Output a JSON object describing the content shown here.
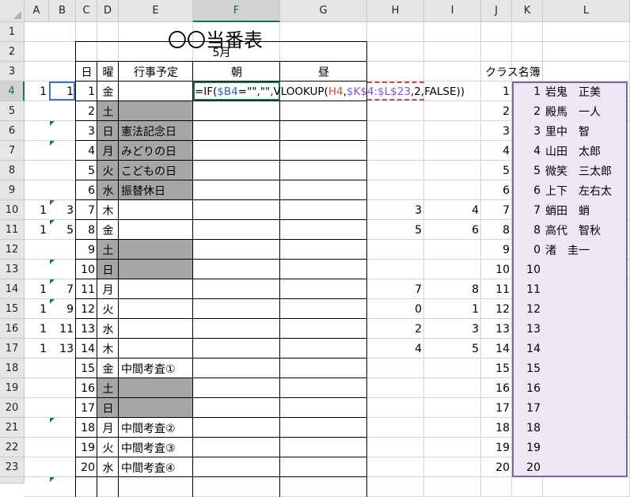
{
  "columns": [
    "A",
    "B",
    "C",
    "D",
    "E",
    "F",
    "G",
    "H",
    "I",
    "J",
    "K",
    "L"
  ],
  "rows": [
    "1",
    "2",
    "3",
    "4",
    "5",
    "6",
    "7",
    "8",
    "9",
    "10",
    "11",
    "12",
    "13",
    "14",
    "15",
    "16",
    "17",
    "18",
    "19",
    "20",
    "21",
    "22",
    "23"
  ],
  "selected_column": "F",
  "selected_row": "4",
  "title": "〇〇当番表",
  "month": "5月",
  "headers": {
    "day": "日",
    "weekday": "曜",
    "event": "行事予定",
    "morning": "朝",
    "noon": "昼"
  },
  "formula_in_cell": "=IF($B4=\"\",\"\",VLOOKUP(H4,$K$4:$L$23,2,FALSE))",
  "class_list_label": "クラス名簿",
  "schedule": [
    {
      "day": "1",
      "wd": "金",
      "ev": "",
      "gray": false
    },
    {
      "day": "2",
      "wd": "土",
      "ev": "",
      "gray": true
    },
    {
      "day": "3",
      "wd": "日",
      "ev": "憲法記念日",
      "gray": true
    },
    {
      "day": "4",
      "wd": "月",
      "ev": "みどりの日",
      "gray": true
    },
    {
      "day": "5",
      "wd": "火",
      "ev": "こどもの日",
      "gray": true
    },
    {
      "day": "6",
      "wd": "水",
      "ev": "振替休日",
      "gray": true
    },
    {
      "day": "7",
      "wd": "木",
      "ev": "",
      "gray": false
    },
    {
      "day": "8",
      "wd": "金",
      "ev": "",
      "gray": false
    },
    {
      "day": "9",
      "wd": "土",
      "ev": "",
      "gray": true
    },
    {
      "day": "10",
      "wd": "日",
      "ev": "",
      "gray": true
    },
    {
      "day": "11",
      "wd": "月",
      "ev": "",
      "gray": false
    },
    {
      "day": "12",
      "wd": "火",
      "ev": "",
      "gray": false
    },
    {
      "day": "13",
      "wd": "水",
      "ev": "",
      "gray": false
    },
    {
      "day": "14",
      "wd": "木",
      "ev": "",
      "gray": false
    },
    {
      "day": "15",
      "wd": "金",
      "ev": "中間考査①",
      "gray": false
    },
    {
      "day": "16",
      "wd": "土",
      "ev": "",
      "gray": true
    },
    {
      "day": "17",
      "wd": "日",
      "ev": "",
      "gray": true
    },
    {
      "day": "18",
      "wd": "月",
      "ev": "中間考査②",
      "gray": false
    },
    {
      "day": "19",
      "wd": "火",
      "ev": "中間考査③",
      "gray": false
    },
    {
      "day": "20",
      "wd": "水",
      "ev": "中間考査④",
      "gray": false
    }
  ],
  "col_a": [
    "1",
    "",
    "",
    "",
    "",
    "",
    "1",
    "1",
    "",
    "",
    "1",
    "1",
    "1",
    "1",
    "",
    "",
    "",
    "",
    "",
    ""
  ],
  "col_b": [
    "1",
    "",
    "",
    "",
    "",
    "",
    "3",
    "5",
    "",
    "",
    "7",
    "9",
    "11",
    "13",
    "",
    "",
    "",
    "",
    "",
    ""
  ],
  "col_h": [
    "",
    "",
    "",
    "",
    "",
    "",
    "3",
    "5",
    "",
    "",
    "7",
    "0",
    "2",
    "4",
    "",
    "",
    "",
    "",
    "",
    ""
  ],
  "col_i": [
    "",
    "",
    "",
    "",
    "",
    "",
    "4",
    "6",
    "",
    "",
    "8",
    "1",
    "3",
    "5",
    "",
    "",
    "",
    "",
    "",
    ""
  ],
  "col_j": [
    "1",
    "2",
    "3",
    "4",
    "5",
    "6",
    "7",
    "8",
    "9",
    "10",
    "11",
    "12",
    "13",
    "14",
    "15",
    "16",
    "17",
    "18",
    "19",
    "20"
  ],
  "col_k": [
    "1",
    "2",
    "3",
    "4",
    "5",
    "6",
    "7",
    "8",
    "0",
    "10",
    "11",
    "12",
    "13",
    "14",
    "15",
    "16",
    "17",
    "18",
    "19",
    "20"
  ],
  "names": [
    "岩鬼　正美",
    "殿馬　一人",
    "里中　智",
    "山田　太郎",
    "微笑　三太郎",
    "上下　左右太",
    "蛸田　蛸",
    "高代　智秋",
    "渚　圭一",
    "",
    "",
    "",
    "",
    "",
    "",
    "",
    "",
    "",
    "",
    ""
  ],
  "colors": {
    "gray_fill": "#a6a6a6",
    "selection": "#217346",
    "ref_blue": "#4472c4",
    "ref_red": "#c0504d",
    "ref_purple": "#8064a2",
    "purple_fill": "#ede7f6",
    "text_blue": "#2e5fb5",
    "text_red": "#c0504d",
    "text_purple": "#7e57c2"
  }
}
